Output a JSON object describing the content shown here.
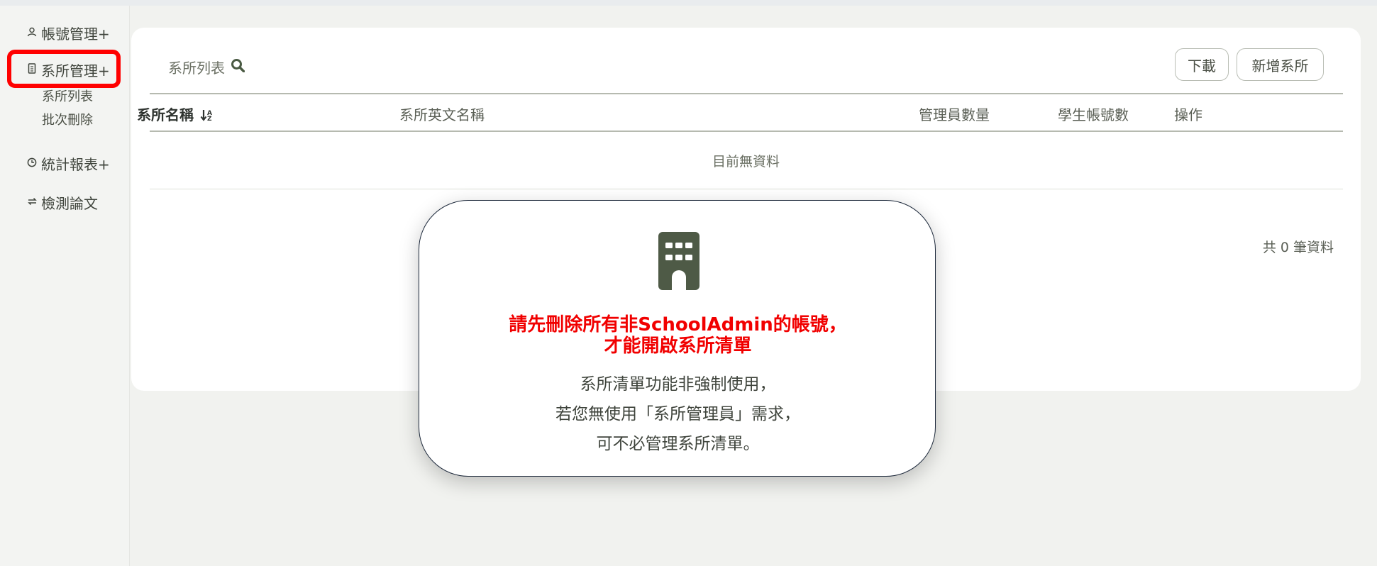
{
  "sidebar": {
    "account": {
      "icon": "user-icon",
      "label": "帳號管理+"
    },
    "dept": {
      "icon": "document-icon",
      "label": "系所管理+",
      "subitems": [
        "系所列表",
        "批次刪除"
      ]
    },
    "stats": {
      "icon": "clock-icon",
      "label": "統計報表+"
    },
    "detect": {
      "icon": "refresh-icon",
      "label": "檢測論文"
    }
  },
  "card": {
    "title": "系所列表",
    "download_label": "下載",
    "add_label": "新增系所",
    "columns": [
      "系所名稱",
      "系所英文名稱",
      "管理員數量",
      "學生帳號數",
      "操作"
    ],
    "sort_icon": "sort-icon",
    "empty_text": "目前無資料",
    "total_text": "共 0 筆資料"
  },
  "modal": {
    "icon": "building-icon",
    "warning_line1": "請先刪除所有非SchoolAdmin的帳號，",
    "warning_line2": "才能開啟系所清單",
    "info_line1": "系所清單功能非強制使用，",
    "info_line2": "若您無使用「系所管理員」需求，",
    "info_line3": "可不必管理系所清單。"
  },
  "colors": {
    "highlight": "#ff0000",
    "warning_text": "#f10000",
    "building": "#4e5a46"
  }
}
